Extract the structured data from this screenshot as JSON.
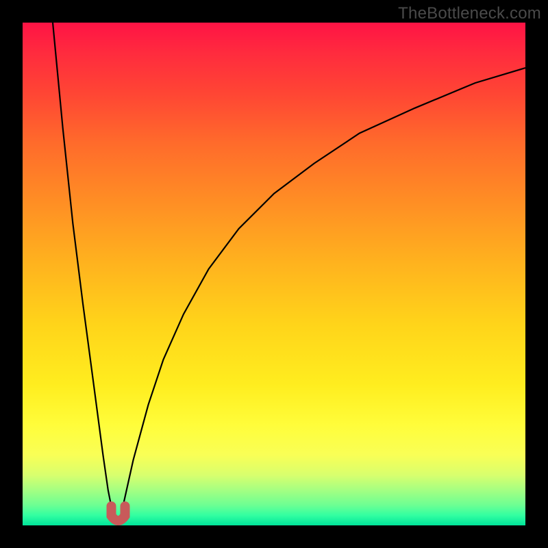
{
  "watermark": "TheBottleneck.com",
  "colors": {
    "frame": "#000000",
    "curve": "#000000",
    "marker": "#c85a5a"
  },
  "chart_data": {
    "type": "line",
    "title": "",
    "xlabel": "",
    "ylabel": "",
    "xlim": [
      0,
      100
    ],
    "ylim": [
      0,
      100
    ],
    "grid": false,
    "legend": false,
    "annotations": [
      {
        "label": "marker-minimum",
        "x": 19,
        "y": 0
      }
    ],
    "series": [
      {
        "name": "left-branch",
        "x": [
          6,
          8,
          10,
          12,
          14,
          16,
          17,
          18,
          19
        ],
        "y": [
          100,
          79,
          60,
          44,
          29,
          14,
          7,
          2,
          0
        ]
      },
      {
        "name": "right-branch",
        "x": [
          19,
          20,
          22,
          25,
          28,
          32,
          37,
          43,
          50,
          58,
          67,
          78,
          90,
          100
        ],
        "y": [
          0,
          4,
          13,
          24,
          33,
          42,
          51,
          59,
          66,
          72,
          78,
          83,
          88,
          91
        ]
      }
    ]
  }
}
